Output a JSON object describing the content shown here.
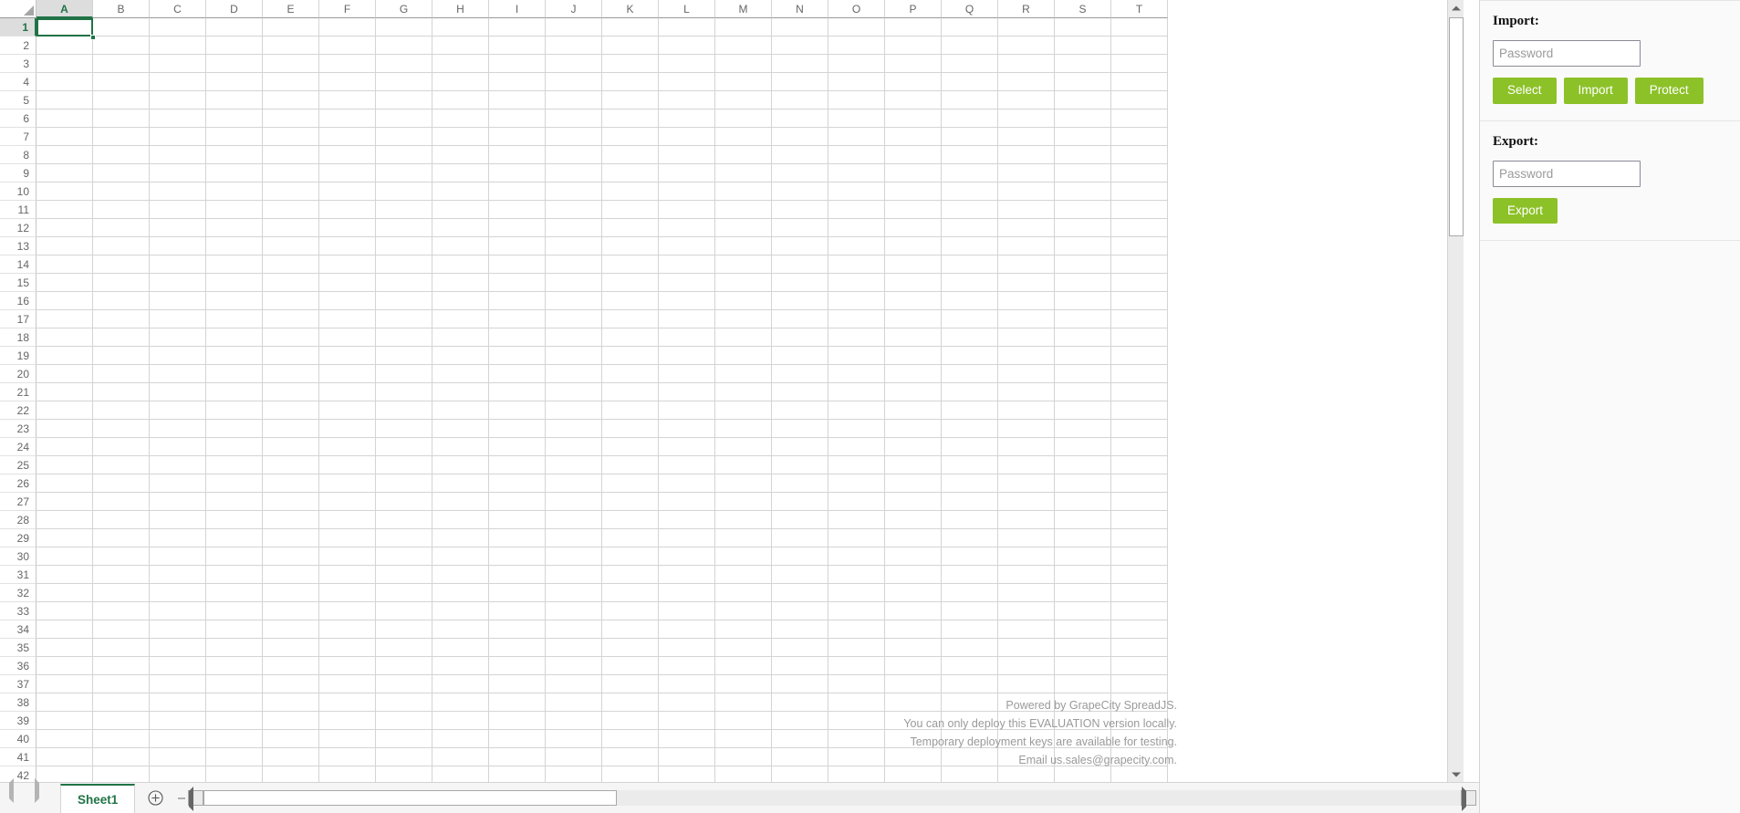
{
  "spreadsheet": {
    "columns": [
      "A",
      "B",
      "C",
      "D",
      "E",
      "F",
      "G",
      "H",
      "I",
      "J",
      "K",
      "L",
      "M",
      "N",
      "O",
      "P",
      "Q",
      "R",
      "S",
      "T"
    ],
    "selected_column": "A",
    "rows": [
      1,
      2,
      3,
      4,
      5,
      6,
      7,
      8,
      9,
      10,
      11,
      12,
      13,
      14,
      15,
      16,
      17,
      18,
      19,
      20,
      21,
      22,
      23,
      24,
      25,
      26,
      27,
      28,
      29,
      30,
      31,
      32,
      33,
      34,
      35,
      36,
      37,
      38,
      39,
      40,
      41,
      42
    ],
    "selected_row": 1,
    "active_cell": "A1",
    "cell_value": "",
    "watermark": [
      "Powered by GrapeCity SpreadJS.",
      "You can only deploy this EVALUATION version locally.",
      "Temporary deployment keys are available for testing.",
      "Email us.sales@grapecity.com."
    ],
    "tabs": [
      {
        "label": "Sheet1",
        "active": true
      }
    ],
    "add_sheet_icon": "plus-circle-icon",
    "prev_sheet_icon": "chevron-left-icon",
    "next_sheet_icon": "chevron-right-icon",
    "scroll_left_icon": "triangle-left-icon",
    "scroll_right_icon": "triangle-right-icon",
    "scroll_up_icon": "triangle-up-icon",
    "scroll_down_icon": "triangle-down-icon",
    "select_all_icon": "select-all-corner-icon"
  },
  "panel": {
    "import": {
      "title": "Import:",
      "password_value": "",
      "password_placeholder": "Password",
      "select_label": "Select",
      "import_label": "Import",
      "protect_label": "Protect"
    },
    "export": {
      "title": "Export:",
      "password_value": "",
      "password_placeholder": "Password",
      "export_label": "Export"
    }
  },
  "colors": {
    "accent_green": "#8cc128",
    "excel_green": "#217346",
    "grid_line": "#d4d4d4",
    "panel_bg": "#fafafa"
  }
}
